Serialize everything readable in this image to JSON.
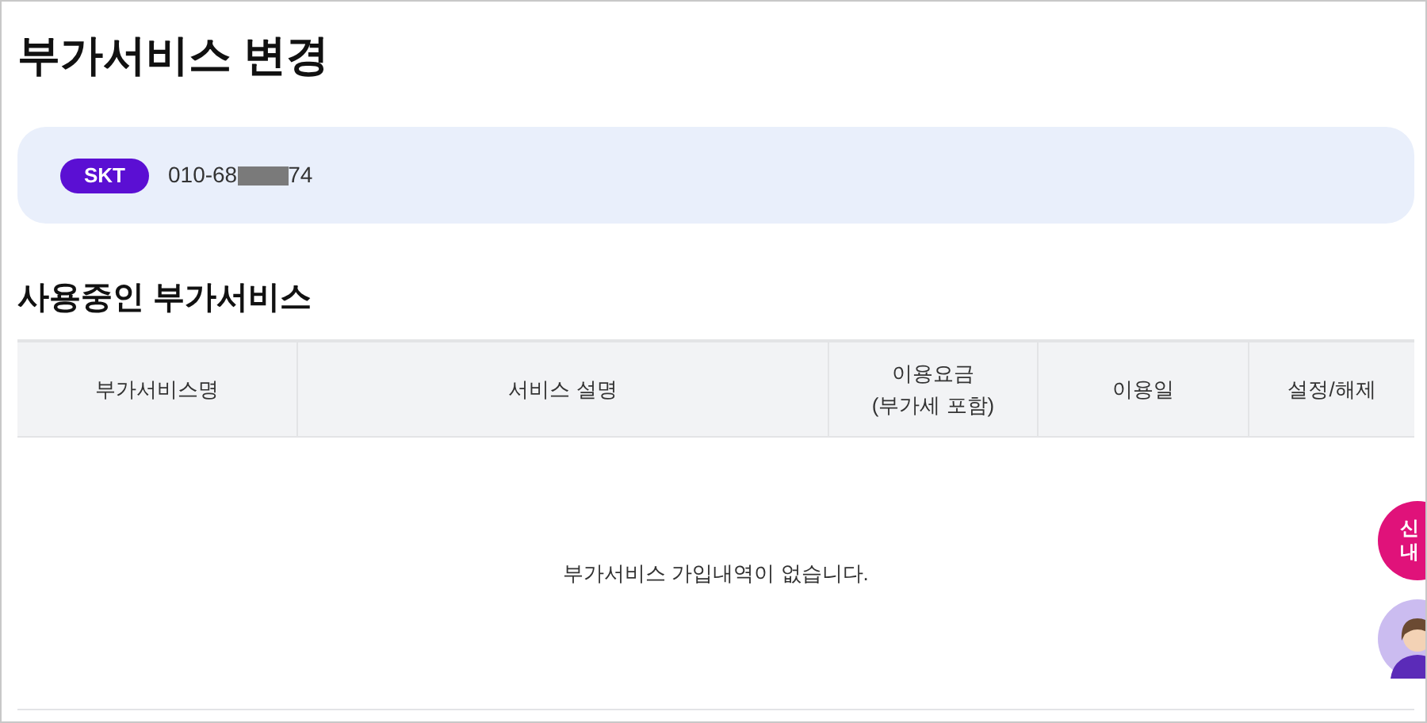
{
  "title": "부가서비스 변경",
  "line": {
    "carrier": "SKT",
    "number_start": "010-68",
    "number_end": "74"
  },
  "section_title": "사용중인 부가서비스",
  "table": {
    "columns": [
      {
        "lines": [
          "부가서비스명"
        ]
      },
      {
        "lines": [
          "서비스 설명"
        ]
      },
      {
        "lines": [
          "이용요금",
          "(부가세 포함)"
        ]
      },
      {
        "lines": [
          "이용일"
        ]
      },
      {
        "lines": [
          "설정/해제"
        ]
      }
    ],
    "empty_message": "부가서비스 가입내역이 없습니다."
  },
  "floating": {
    "history_button_lines": [
      "신",
      "내"
    ]
  }
}
